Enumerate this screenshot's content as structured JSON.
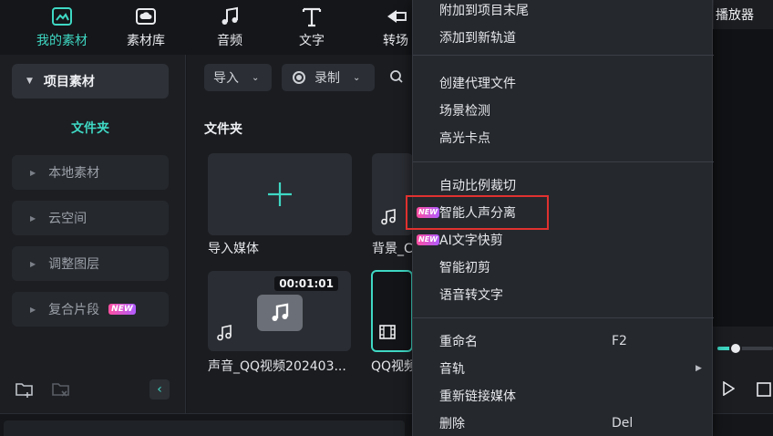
{
  "toolbar": {
    "tabs": [
      {
        "label": "我的素材",
        "icon": "my-media-icon",
        "active": true
      },
      {
        "label": "素材库",
        "icon": "stock-library-icon"
      },
      {
        "label": "音频",
        "icon": "music-note-icon"
      },
      {
        "label": "文字",
        "icon": "text-t-icon"
      },
      {
        "label": "转场",
        "icon": "transition-icon"
      }
    ],
    "player_title": "播放器"
  },
  "sidebar": {
    "header": "项目素材",
    "folder": "文件夹",
    "items": [
      {
        "label": "本地素材"
      },
      {
        "label": "云空间"
      },
      {
        "label": "调整图层"
      },
      {
        "label": "复合片段",
        "badge": "NEW"
      }
    ]
  },
  "media": {
    "import_btn": "导入",
    "record_btn": "录制",
    "section_title": "文件夹",
    "cards": [
      {
        "label": "导入媒体",
        "type": "import"
      },
      {
        "label": "背景_C",
        "type": "audio"
      },
      {
        "label": "声音_QQ视频202403...",
        "type": "audio",
        "duration": "00:01:01"
      },
      {
        "label": "QQ视频",
        "type": "video"
      }
    ]
  },
  "context_menu": {
    "groups": [
      [
        {
          "label": "附加到项目末尾"
        },
        {
          "label": "添加到新轨道"
        }
      ],
      [
        {
          "label": "创建代理文件"
        },
        {
          "label": "场景检测"
        },
        {
          "label": "高光卡点"
        }
      ],
      [
        {
          "label": "自动比例裁切"
        },
        {
          "label": "智能人声分离",
          "badge": "NEW",
          "highlighted": true
        },
        {
          "label": "AI文字快剪",
          "badge": "NEW"
        },
        {
          "label": "智能初剪"
        },
        {
          "label": "语音转文字"
        }
      ],
      [
        {
          "label": "重命名",
          "shortcut": "F2"
        },
        {
          "label": "音轨",
          "submenu": true
        },
        {
          "label": "重新链接媒体"
        },
        {
          "label": "删除",
          "shortcut": "Del"
        }
      ]
    ]
  },
  "colors": {
    "accent": "#3fd8c4",
    "highlight": "#e0312f"
  }
}
